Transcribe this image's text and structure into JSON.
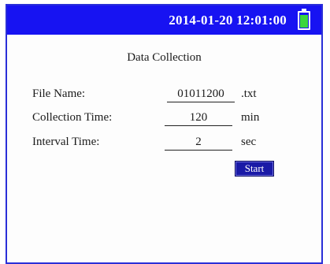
{
  "status_bar": {
    "datetime": "2014-01-20 12:01:00",
    "battery": {
      "icon": "battery-icon",
      "level": 1.0,
      "fill_color": "#3cd63c"
    },
    "background_color": "#1713f2"
  },
  "panel": {
    "title": "Data Collection",
    "fields": {
      "file_name": {
        "label": "File Name:",
        "value": "01011200",
        "unit": ".txt"
      },
      "collection_time": {
        "label": "Collection Time:",
        "value": "120",
        "unit": "min"
      },
      "interval_time": {
        "label": "Interval Time:",
        "value": "2",
        "unit": "sec"
      }
    },
    "start_label": "Start"
  }
}
